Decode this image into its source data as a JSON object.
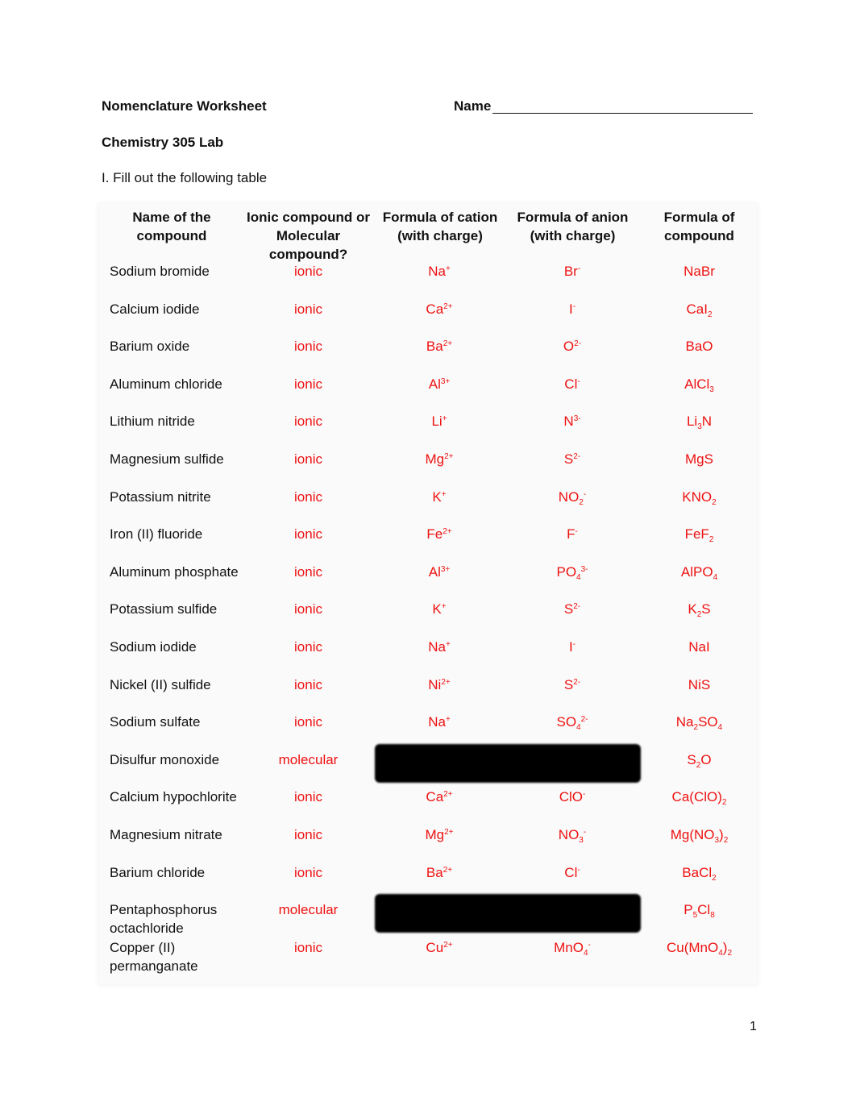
{
  "header": {
    "title": "Nomenclature Worksheet",
    "name_label": "Name",
    "course": "Chemistry 305 Lab",
    "instruction": "I. Fill out the following table"
  },
  "table": {
    "columns": [
      "Name of the compound",
      "Ionic compound or Molecular compound?",
      "Formula of cation (with charge)",
      "Formula of anion (with charge)",
      "Formula of compound"
    ],
    "rows": [
      {
        "name": "Sodium bromide",
        "type": "ionic",
        "cation": [
          [
            "n",
            "Na"
          ],
          [
            "sup",
            "+"
          ]
        ],
        "anion": [
          [
            "n",
            "Br"
          ],
          [
            "sup",
            "-"
          ]
        ],
        "formula": [
          [
            "n",
            "NaBr"
          ]
        ]
      },
      {
        "name": "Calcium iodide",
        "type": "ionic",
        "cation": [
          [
            "n",
            "Ca"
          ],
          [
            "sup",
            "2+"
          ]
        ],
        "anion": [
          [
            "n",
            "I"
          ],
          [
            "sup",
            "-"
          ]
        ],
        "formula": [
          [
            "n",
            "CaI"
          ],
          [
            "sub",
            "2"
          ]
        ]
      },
      {
        "name": "Barium oxide",
        "type": "ionic",
        "cation": [
          [
            "n",
            "Ba"
          ],
          [
            "sup",
            "2+"
          ]
        ],
        "anion": [
          [
            "n",
            "O"
          ],
          [
            "sup",
            "2-"
          ]
        ],
        "formula": [
          [
            "n",
            "BaO"
          ]
        ]
      },
      {
        "name": "Aluminum chloride",
        "type": "ionic",
        "cation": [
          [
            "n",
            "Al"
          ],
          [
            "sup",
            "3+"
          ]
        ],
        "anion": [
          [
            "n",
            "Cl"
          ],
          [
            "sup",
            "-"
          ]
        ],
        "formula": [
          [
            "n",
            "AlCl"
          ],
          [
            "sub",
            "3"
          ]
        ]
      },
      {
        "name": "Lithium nitride",
        "type": "ionic",
        "cation": [
          [
            "n",
            "Li"
          ],
          [
            "sup",
            "+"
          ]
        ],
        "anion": [
          [
            "n",
            "N"
          ],
          [
            "sup",
            "3-"
          ]
        ],
        "formula": [
          [
            "n",
            "Li"
          ],
          [
            "sub",
            "3"
          ],
          [
            "n",
            "N"
          ]
        ]
      },
      {
        "name": "Magnesium sulfide",
        "type": "ionic",
        "cation": [
          [
            "n",
            "Mg"
          ],
          [
            "sup",
            "2+"
          ]
        ],
        "anion": [
          [
            "n",
            "S"
          ],
          [
            "sup",
            "2-"
          ]
        ],
        "formula": [
          [
            "n",
            "MgS"
          ]
        ]
      },
      {
        "name": "Potassium nitrite",
        "type": "ionic",
        "cation": [
          [
            "n",
            "K"
          ],
          [
            "sup",
            "+"
          ]
        ],
        "anion": [
          [
            "n",
            "NO"
          ],
          [
            "sub",
            "2"
          ],
          [
            "sup",
            "-"
          ]
        ],
        "formula": [
          [
            "n",
            "KNO"
          ],
          [
            "sub",
            "2"
          ]
        ]
      },
      {
        "name": "Iron (II) fluoride",
        "type": "ionic",
        "cation": [
          [
            "n",
            "Fe"
          ],
          [
            "sup",
            "2+"
          ]
        ],
        "anion": [
          [
            "n",
            "F"
          ],
          [
            "sup",
            "-"
          ]
        ],
        "formula": [
          [
            "n",
            "FeF"
          ],
          [
            "sub",
            "2"
          ]
        ]
      },
      {
        "name": "Aluminum phosphate",
        "type": "ionic",
        "cation": [
          [
            "n",
            "Al"
          ],
          [
            "sup",
            "3+"
          ]
        ],
        "anion": [
          [
            "n",
            "PO"
          ],
          [
            "sub",
            "4"
          ],
          [
            "sup",
            "3-"
          ]
        ],
        "formula": [
          [
            "n",
            "AlPO"
          ],
          [
            "sub",
            "4"
          ]
        ]
      },
      {
        "name": "Potassium sulfide",
        "type": "ionic",
        "cation": [
          [
            "n",
            "K"
          ],
          [
            "sup",
            "+"
          ]
        ],
        "anion": [
          [
            "n",
            "S"
          ],
          [
            "sup",
            "2-"
          ]
        ],
        "formula": [
          [
            "n",
            "K"
          ],
          [
            "sub",
            "2"
          ],
          [
            "n",
            "S"
          ]
        ]
      },
      {
        "name": "Sodium iodide",
        "type": "ionic",
        "cation": [
          [
            "n",
            "Na"
          ],
          [
            "sup",
            "+"
          ]
        ],
        "anion": [
          [
            "n",
            "I"
          ],
          [
            "sup",
            "-"
          ]
        ],
        "formula": [
          [
            "n",
            "NaI"
          ]
        ]
      },
      {
        "name": "Nickel (II) sulfide",
        "type": "ionic",
        "cation": [
          [
            "n",
            "Ni"
          ],
          [
            "sup",
            "2+"
          ]
        ],
        "anion": [
          [
            "n",
            "S"
          ],
          [
            "sup",
            "2-"
          ]
        ],
        "formula": [
          [
            "n",
            "NiS"
          ]
        ]
      },
      {
        "name": "Sodium sulfate",
        "type": "ionic",
        "cation": [
          [
            "n",
            "Na"
          ],
          [
            "sup",
            "+"
          ]
        ],
        "anion": [
          [
            "n",
            "SO"
          ],
          [
            "sub",
            "4"
          ],
          [
            "sup",
            "2-"
          ]
        ],
        "formula": [
          [
            "n",
            "Na"
          ],
          [
            "sub",
            "2"
          ],
          [
            "n",
            "SO"
          ],
          [
            "sub",
            "4"
          ]
        ]
      },
      {
        "name": "Disulfur monoxide",
        "type": "molecular",
        "cation": [],
        "anion": [],
        "formula": [
          [
            "n",
            "S"
          ],
          [
            "sub",
            "2"
          ],
          [
            "n",
            "O"
          ]
        ],
        "redacted": true
      },
      {
        "name": "Calcium hypochlorite",
        "type": "ionic",
        "cation": [
          [
            "n",
            "Ca"
          ],
          [
            "sup",
            "2+"
          ]
        ],
        "anion": [
          [
            "n",
            "ClO"
          ],
          [
            "sup",
            "-"
          ]
        ],
        "formula": [
          [
            "n",
            "Ca(ClO)"
          ],
          [
            "sub",
            "2"
          ]
        ]
      },
      {
        "name": "Magnesium nitrate",
        "type": "ionic",
        "cation": [
          [
            "n",
            "Mg"
          ],
          [
            "sup",
            "2+"
          ]
        ],
        "anion": [
          [
            "n",
            "NO"
          ],
          [
            "sub",
            "3"
          ],
          [
            "sup",
            "-"
          ]
        ],
        "formula": [
          [
            "n",
            "Mg(NO"
          ],
          [
            "sub",
            "3"
          ],
          [
            "n",
            ")"
          ],
          [
            "sub",
            "2"
          ]
        ]
      },
      {
        "name": "Barium chloride",
        "type": "ionic",
        "cation": [
          [
            "n",
            "Ba"
          ],
          [
            "sup",
            "2+"
          ]
        ],
        "anion": [
          [
            "n",
            "Cl"
          ],
          [
            "sup",
            "-"
          ]
        ],
        "formula": [
          [
            "n",
            "BaCl"
          ],
          [
            "sub",
            "2"
          ]
        ]
      },
      {
        "name": "Pentaphosphorus octachloride",
        "type": "molecular",
        "cation": [],
        "anion": [],
        "formula": [
          [
            "n",
            "P"
          ],
          [
            "sub",
            "5"
          ],
          [
            "n",
            "Cl"
          ],
          [
            "sub",
            "8"
          ]
        ],
        "redacted": true
      },
      {
        "name": "Copper (II) permanganate",
        "type": "ionic",
        "cation": [
          [
            "n",
            "Cu"
          ],
          [
            "sup",
            "2+"
          ]
        ],
        "anion": [
          [
            "n",
            "MnO"
          ],
          [
            "sub",
            "4"
          ],
          [
            "sup",
            "-"
          ]
        ],
        "formula": [
          [
            "n",
            "Cu(MnO"
          ],
          [
            "sub",
            "4"
          ],
          [
            "n",
            ")"
          ],
          [
            "sub",
            "2"
          ]
        ]
      }
    ]
  },
  "colors": {
    "answer": "#ee1111",
    "redaction": "#000000"
  },
  "footer": {
    "page_number": "1"
  }
}
